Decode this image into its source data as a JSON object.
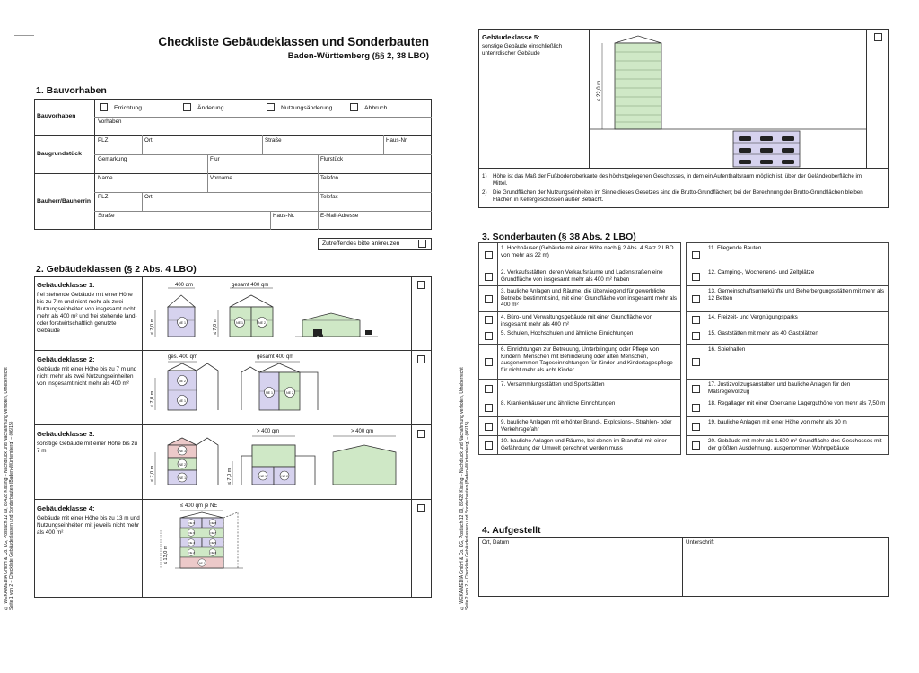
{
  "left": {
    "title": "Checkliste Gebäudeklassen und Sonderbauten",
    "subtitle": "Baden-Württemberg (§§ 2, 38 LBO)",
    "side_note_1": "© WEKA MEDIA GmbH & Co. KG, Postfach 12 09, 86428 Kissing – Nachdruck und Nachahmung verboten, Urheberrecht",
    "side_note_2": "Seite 1 von 2 – Checkliste Gebäudeklassen und Sonderbauten (Baden-Württemberg) – (06/15)",
    "section1": {
      "heading": "1. Bauvorhaben",
      "row_labels": [
        "Bauvorhaben",
        "Baugrundstück",
        "Bauherr/Bauherrin"
      ],
      "options": [
        "Errichtung",
        "Änderung",
        "Nutzungsänderung",
        "Abbruch"
      ],
      "vorhaben": "Vorhaben",
      "plz": "PLZ",
      "ort": "Ort",
      "strasse": "Straße",
      "hausnr": "Haus-Nr.",
      "gemarkung": "Gemarkung",
      "flur": "Flur",
      "flurstueck": "Flurstück",
      "name": "Name",
      "vorname": "Vorname",
      "telefon": "Telefon",
      "telefax": "Telefax",
      "email": "E-Mail-Adresse",
      "zutreffendes": "Zutreffendes bitte ankreuzen"
    },
    "section2": {
      "heading": "2. Gebäudeklassen (§ 2 Abs. 4 LBO)",
      "classes": [
        {
          "title": "Gebäudeklasse 1:",
          "text": "frei stehende Gebäude mit einer Höhe bis zu 7 m und nicht mehr als zwei Nutzungseinheiten von insgesamt nicht mehr als 400 m² und frei stehende land- oder forstwirtschaftlich genutzte Gebäude"
        },
        {
          "title": "Gebäudeklasse 2:",
          "text": "Gebäude mit einer Höhe bis zu 7 m und nicht mehr als zwei Nutzungseinheiten von insgesamt nicht mehr als 400 m²"
        },
        {
          "title": "Gebäudeklasse 3:",
          "text": "sonstige Gebäude mit einer Höhe bis zu 7 m"
        },
        {
          "title": "Gebäudeklasse 4:",
          "text": "Gebäude mit einer Höhe bis zu 13 m und Nutzungseinheiten mit jeweils nicht mehr als 400 m²"
        }
      ],
      "lbl_400": "400 qm",
      "lbl_ges400": "gesamt 400 qm",
      "lbl_ges_400": "ges. 400 qm",
      "lbl_gt400": "> 400 qm",
      "lbl_le400je": "≤ 400 qm je NE",
      "lbl_7m": "≤ 7,0 m",
      "lbl_13m": "≤ 13,0 m",
      "ne1": "NE 1",
      "ne2": "NE 2",
      "ne3": "NE 3",
      "ne4": "NE 4",
      "ne5": "NE 5",
      "ne6": "NE 6",
      "ne7": "NE 7",
      "ne8": "NE 8",
      "ne9": "NE 9"
    }
  },
  "right": {
    "side_note_1": "© WEKA MEDIA GmbH & Co. KG, Postfach 12 09, 86428 Kissing – Nachdruck und Nachahmung verboten, Urheberrecht",
    "side_note_2": "Seite 2 von 2 – Checkliste Gebäudeklassen und Sonderbauten (Baden-Württemberg) – (06/15)",
    "gk5": {
      "title": "Gebäudeklasse 5:",
      "text": "sonstige Gebäude einschließlich unterirdischer Gebäude",
      "height": "≤ 22,0 m",
      "notes": [
        {
          "num": "1)",
          "text": "Höhe ist das Maß der Fußbodenoberkante des höchstgelegenen Geschosses, in dem ein Aufenthaltsraum möglich ist, über der Geländeoberfläche im Mittel."
        },
        {
          "num": "2)",
          "text": "Die Grundflächen der Nutzungseinheiten im Sinne dieses Gesetzes sind die Brutto-Grundflächen; bei der Berechnung der Brutto-Grundflächen bleiben Flächen in Kellergeschossen außer Betracht."
        }
      ]
    },
    "section3": {
      "heading": "3. Sonderbauten (§ 38 Abs. 2 LBO)",
      "left_items": [
        "1. Hochhäuser (Gebäude mit einer Höhe nach § 2 Abs. 4 Satz 2 LBO von mehr als 22 m)",
        "2. Verkaufsstätten, deren Verkaufsräume und Ladenstraßen eine Grundfläche von insgesamt mehr als 400 m² haben",
        "3. bauliche Anlagen und Räume, die überwiegend für gewerbliche Betriebe bestimmt sind, mit einer Grundfläche von insgesamt mehr als 400 m²",
        "4. Büro- und Verwaltungsgebäude mit einer Grundfläche von insgesamt mehr als 400 m²",
        "5. Schulen, Hochschulen und ähnliche Einrichtungen",
        "6. Einrichtungen zur Betreuung, Unterbringung oder Pflege von Kindern, Menschen mit Behinderung oder alten Menschen, ausgenommen Tageseinrichtungen für Kinder und Kindertagespflege für nicht mehr als acht Kinder",
        "7. Versammlungsstätten und Sportstätten",
        "8. Krankenhäuser und ähnliche Einrichtungen",
        "9. bauliche Anlagen mit erhöhter Brand-, Explosions-, Strahlen- oder Verkehrsgefahr",
        "10. bauliche Anlagen und Räume, bei denen im Brandfall mit einer Gefährdung der Umwelt gerechnet werden muss"
      ],
      "right_items": [
        "11. Fliegende Bauten",
        "12. Camping-, Wochenend- und Zeltplätze",
        "13. Gemeinschaftsunterkünfte und Beherbergungsstätten mit mehr als 12 Betten",
        "14. Freizeit- und Vergnügungsparks",
        "15. Gaststätten mit mehr als 40 Gastplätzen",
        "16. Spielhallen",
        "17. Justizvollzugsanstalten und bauliche Anlagen für den Maßregelvollzug",
        "18. Regallager mit einer Oberkante Lagerguthöhe von mehr als 7,50 m",
        "19. bauliche Anlagen mit einer Höhe von mehr als 30 m",
        "20. Gebäude mit mehr als 1.600 m² Grundfläche des Geschosses mit der größten Ausdehnung, ausgenommen Wohngebäude"
      ]
    },
    "section4": {
      "heading": "4. Aufgestellt",
      "ort_datum": "Ort, Datum",
      "unterschrift": "Unterschrift"
    }
  },
  "colors": {
    "green": "#cfe8c6",
    "purple": "#d6d2ee",
    "pink": "#ecc9c9",
    "border": "#333333"
  }
}
